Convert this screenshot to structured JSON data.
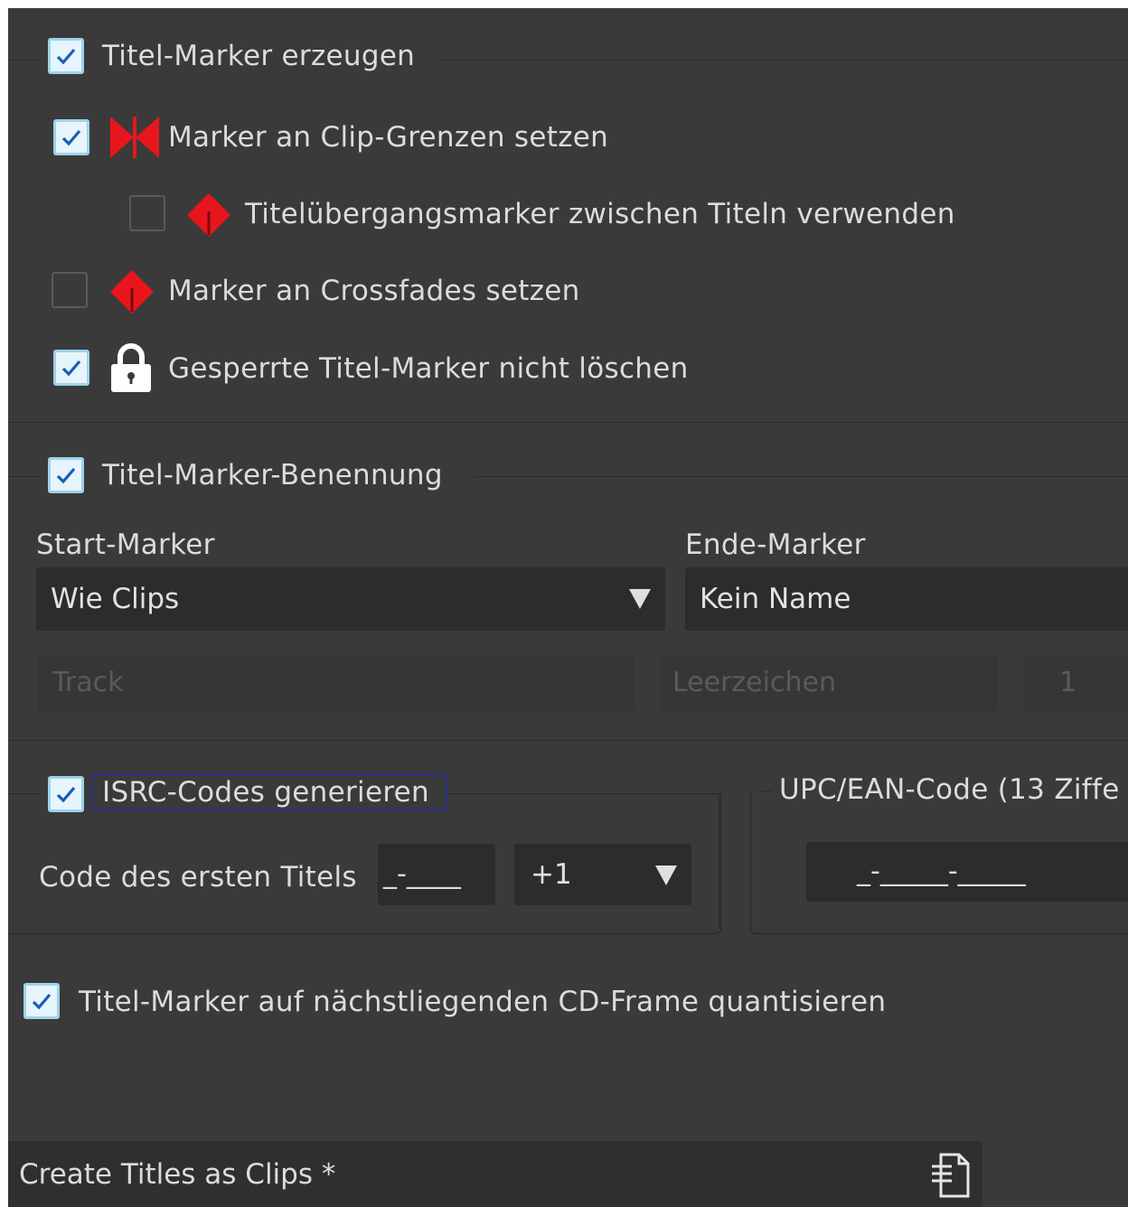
{
  "colors": {
    "panel_bg": "#3a3a3a",
    "field_bg": "#2c2c2c",
    "checkbox_checked_bg": "#e6f4fb",
    "checkmark": "#1a5fb4",
    "marker_red": "#e8161c",
    "text": "#dcdcdc",
    "disabled_text": "#5a5a5a"
  },
  "group_markers": {
    "title": "Titel-Marker erzeugen",
    "checked": true,
    "options": [
      {
        "label": "Marker an Clip-Grenzen setzen",
        "checked": true,
        "icon": "clip-boundary-marker-icon"
      },
      {
        "label": "Titelübergangsmarker zwischen Titeln verwenden",
        "checked": false,
        "icon": "transition-marker-icon"
      },
      {
        "label": "Marker an Crossfades setzen",
        "checked": false,
        "icon": "crossfade-marker-icon"
      },
      {
        "label": "Gesperrte Titel-Marker nicht löschen",
        "checked": true,
        "icon": "lock-icon"
      }
    ]
  },
  "group_naming": {
    "title": "Titel-Marker-Benennung",
    "checked": true,
    "start_label": "Start-Marker",
    "start_value": "Wie Clips",
    "end_label": "Ende-Marker",
    "end_value": "Kein Name",
    "track_placeholder": "Track",
    "separator_placeholder": "Leerzeichen",
    "number_placeholder": "1"
  },
  "group_isrc": {
    "title": "ISRC-Codes generieren",
    "checked": true,
    "code_label": "Code des ersten Titels",
    "code_value": "_-____",
    "increment": "+1"
  },
  "group_upc": {
    "title": "UPC/EAN-Code (13 Ziffe",
    "value": "_-_____-_____"
  },
  "quantize": {
    "label": "Titel-Marker auf nächstliegenden CD-Frame quantisieren",
    "checked": true
  },
  "bottom_bar": {
    "label": "Create Titles as Clips *",
    "icon": "document-list-icon"
  }
}
